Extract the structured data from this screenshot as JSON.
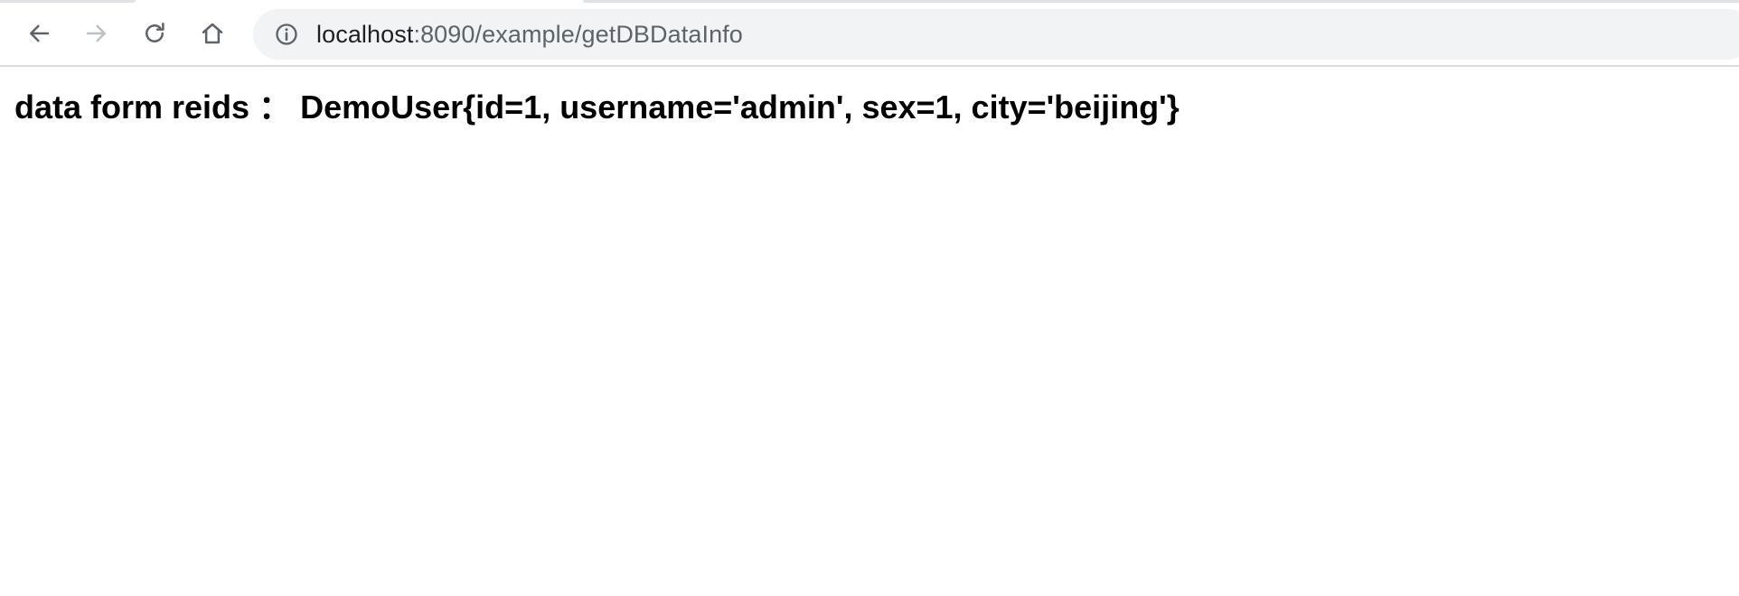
{
  "browser": {
    "url": {
      "host": "localhost",
      "rest": ":8090/example/getDBDataInfo"
    },
    "icons": {
      "back": "arrow-left-icon",
      "forward": "arrow-right-icon",
      "reload": "reload-icon",
      "home": "home-icon",
      "site_info": "info-circle-icon"
    },
    "colors": {
      "omnibox_bg": "#f1f3f4",
      "icon_active": "#5f6368",
      "icon_disabled": "#bdc1c6"
    }
  },
  "page": {
    "text": "data form reids ： DemoUser{id=1, username='admin', sex=1, city='beijing'}"
  }
}
